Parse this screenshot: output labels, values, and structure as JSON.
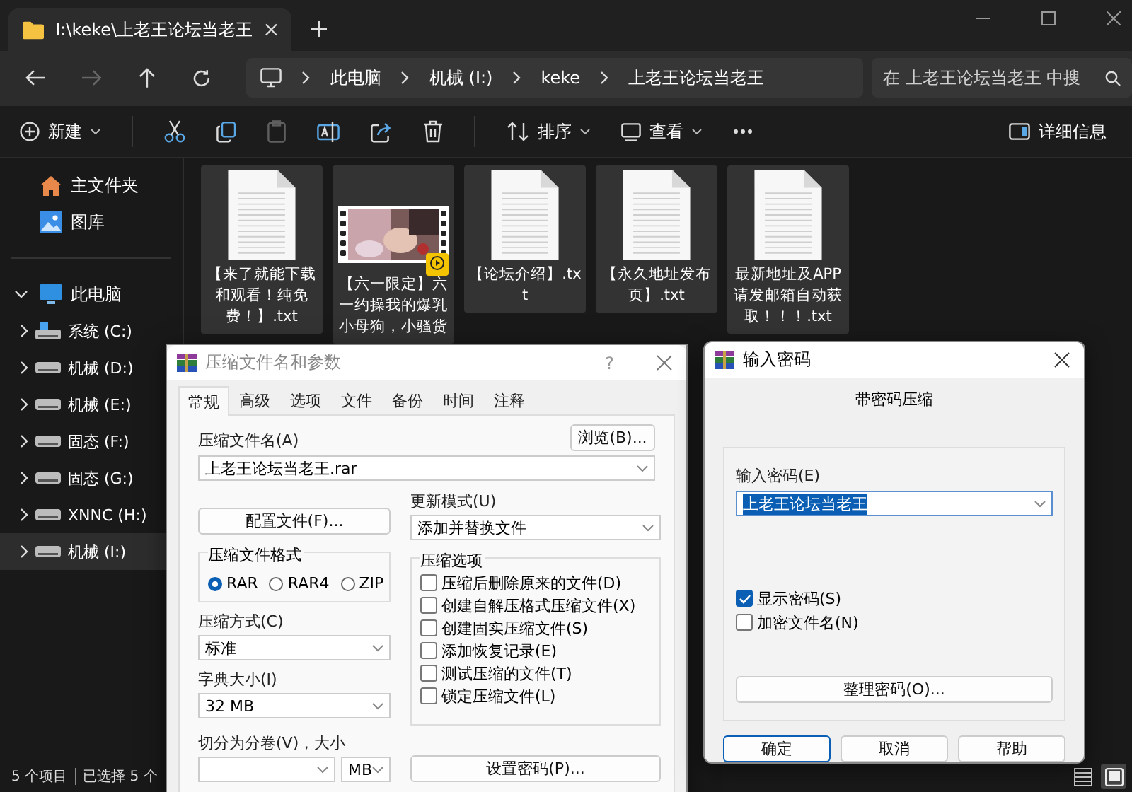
{
  "window": {
    "tab_title": "I:\\keke\\上老王论坛当老王"
  },
  "address": {
    "path": [
      "此电脑",
      "机械 (I:)",
      "keke",
      "上老王论坛当老王"
    ],
    "search_placeholder": "在 上老王论坛当老王 中搜"
  },
  "toolbar": {
    "new_label": "新建",
    "actions": [
      {
        "kind": "cut",
        "disabled": false
      },
      {
        "kind": "copy",
        "disabled": false
      },
      {
        "kind": "paste",
        "disabled": true
      },
      {
        "kind": "rename",
        "disabled": false
      },
      {
        "kind": "share",
        "disabled": false
      },
      {
        "kind": "delete",
        "disabled": false
      }
    ],
    "sort_label": "排序",
    "view_label": "查看",
    "details_label": "详细信息"
  },
  "sidebar": {
    "quick": [
      {
        "label": "主文件夹",
        "kind": "home"
      },
      {
        "label": "图库",
        "kind": "gallery"
      }
    ],
    "pc": {
      "label": "此电脑",
      "expanded": true,
      "children": [
        {
          "label": "系统 (C:)",
          "kind": "system",
          "selected": false
        },
        {
          "label": "机械 (D:)",
          "kind": "drive",
          "selected": false
        },
        {
          "label": "机械 (E:)",
          "kind": "drive",
          "selected": false
        },
        {
          "label": "固态 (F:)",
          "kind": "drive",
          "selected": false
        },
        {
          "label": "固态 (G:)",
          "kind": "drive",
          "selected": false
        },
        {
          "label": "XNNC (H:)",
          "kind": "drive",
          "selected": false
        },
        {
          "label": "机械 (I:)",
          "kind": "drive",
          "selected": true
        }
      ]
    }
  },
  "files": [
    {
      "name": "【来了就能下载和观看！纯免费！】.txt",
      "kind": "text",
      "selected": true
    },
    {
      "name": "【六一限定】六一约操我的爆乳小母狗，小骚货",
      "kind": "video",
      "selected": true
    },
    {
      "name": "【论坛介绍】.txt",
      "kind": "text",
      "selected": true
    },
    {
      "name": "【永久地址发布页】.txt",
      "kind": "text",
      "selected": true
    },
    {
      "name": "最新地址及APP请发邮箱自动获取！！！.txt",
      "kind": "text",
      "selected": true
    }
  ],
  "status": {
    "count": "5 个项目",
    "selection": "已选择 5 个",
    "view_buttons": [
      {
        "kind": "details",
        "selected": false
      },
      {
        "kind": "tiles",
        "selected": true
      }
    ]
  },
  "archive_dialog": {
    "title": "压缩文件名和参数",
    "help": "?",
    "tabs": [
      {
        "label": "常规",
        "selected": true
      },
      {
        "label": "高级",
        "selected": false
      },
      {
        "label": "选项",
        "selected": false
      },
      {
        "label": "文件",
        "selected": false
      },
      {
        "label": "备份",
        "selected": false
      },
      {
        "label": "时间",
        "selected": false
      },
      {
        "label": "注释",
        "selected": false
      }
    ],
    "name_label": "压缩文件名(A)",
    "name_value": "上老王论坛当老王.rar",
    "browse": "浏览(B)...",
    "profiles": "配置文件(F)...",
    "update_label": "更新模式(U)",
    "update_value": "添加并替换文件",
    "format_label": "压缩文件格式",
    "formats": [
      {
        "label": "RAR",
        "selected": true
      },
      {
        "label": "RAR4",
        "selected": false
      },
      {
        "label": "ZIP",
        "selected": false
      }
    ],
    "options_label": "压缩选项",
    "options": [
      {
        "label": "压缩后删除原来的文件(D)",
        "checked": false
      },
      {
        "label": "创建自解压格式压缩文件(X)",
        "checked": false
      },
      {
        "label": "创建固实压缩文件(S)",
        "checked": false
      },
      {
        "label": "添加恢复记录(E)",
        "checked": false
      },
      {
        "label": "测试压缩的文件(T)",
        "checked": false
      },
      {
        "label": "锁定压缩文件(L)",
        "checked": false
      }
    ],
    "method_label": "压缩方式(C)",
    "method_value": "标准",
    "dict_label": "字典大小(I)",
    "dict_value": "32 MB",
    "split_label": "切分为分卷(V)，大小",
    "split_unit": "MB",
    "set_password": "设置密码(P)..."
  },
  "password_dialog": {
    "title": "输入密码",
    "subtitle": "带密码压缩",
    "password_label": "输入密码(E)",
    "password_value": "上老王论坛当老王",
    "checks": [
      {
        "label": "显示密码(S)",
        "checked": true
      },
      {
        "label": "加密文件名(N)",
        "checked": false
      }
    ],
    "organize": "整理密码(O)...",
    "buttons": [
      {
        "label": "确定",
        "selected": true
      },
      {
        "label": "取消",
        "selected": false
      },
      {
        "label": "帮助",
        "selected": false
      }
    ]
  }
}
